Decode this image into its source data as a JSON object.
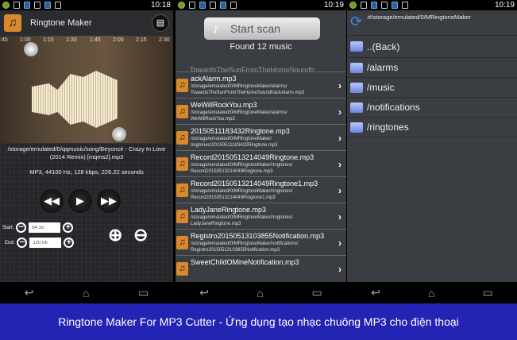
{
  "status": {
    "time1": "10:18",
    "time2": "10:19",
    "time3": "10:19"
  },
  "editor": {
    "title": "Ringtone Maker",
    "ticks": [
      ":45",
      "1:00",
      "1:15",
      "1:30",
      "1:45",
      "2:00",
      "2:15",
      "2:30"
    ],
    "file_path": "/storage/emulated/0/qqmusic/song/Beyoncé - Crazy In Love (2014 Remix) [mqms2].mp3",
    "info": "MP3, 44100 Hz, 128 kbps, 226.22 seconds",
    "start_label": "Start:",
    "start_value": "64.16",
    "end_label": "End:",
    "end_value": "120.06"
  },
  "scan": {
    "button": "Start scan",
    "found": "Found 12 music",
    "partial_top": "TowardsTheSunFromTheHomeSoundtr",
    "items": [
      {
        "name": "ackAlarm.mp3",
        "path": "/storage/emulated/0/MRingtoneMaker/alarms/ TowardsTheSunFromTheHomeSoundtrackAlarm.mp3"
      },
      {
        "name": "WeWillRockYou.mp3",
        "path": "/storage/emulated/0/MRingtoneMaker/alarms/ WeWillRockYou.mp3"
      },
      {
        "name": "20150511183432Ringtone.mp3",
        "path": "/storage/emulated/0/MRingtoneMaker/ ringtones/20150511183432Ringtone.mp3"
      },
      {
        "name": "Record20150513214049Ringtone.mp3",
        "path": "/storage/emulated/0/MRingtoneMaker/ringtones/ Record20150513214049Ringtone.mp3"
      },
      {
        "name": "Record20150513214049Ringtone1.mp3",
        "path": "/storage/emulated/0/MRingtoneMaker/ringtones/ Record20150513214049Ringtone1.mp3"
      },
      {
        "name": "LadyJaneRingtone.mp3",
        "path": "/storage/emulated/0/MRingtoneMaker/ringtones/ LadyJaneRingtone.mp3"
      },
      {
        "name": "Registro20150513103855Notification.mp3",
        "path": "/storage/emulated/0/MRingtoneMaker/notifications/ Registro20150513103855Notification.mp3"
      },
      {
        "name": "SweetChildOMineNotification.mp3",
        "path": ""
      }
    ]
  },
  "browser": {
    "path": ".#/storage/emulated/0/MRingtoneMaker",
    "back": "..(Back)",
    "folders": [
      "/alarms",
      "/music",
      "/notifications",
      "/ringtones"
    ]
  },
  "banner": "Ringtone Maker For MP3 Cutter - Ứng dụng tạo nhạc chuông MP3 cho điện thoại"
}
